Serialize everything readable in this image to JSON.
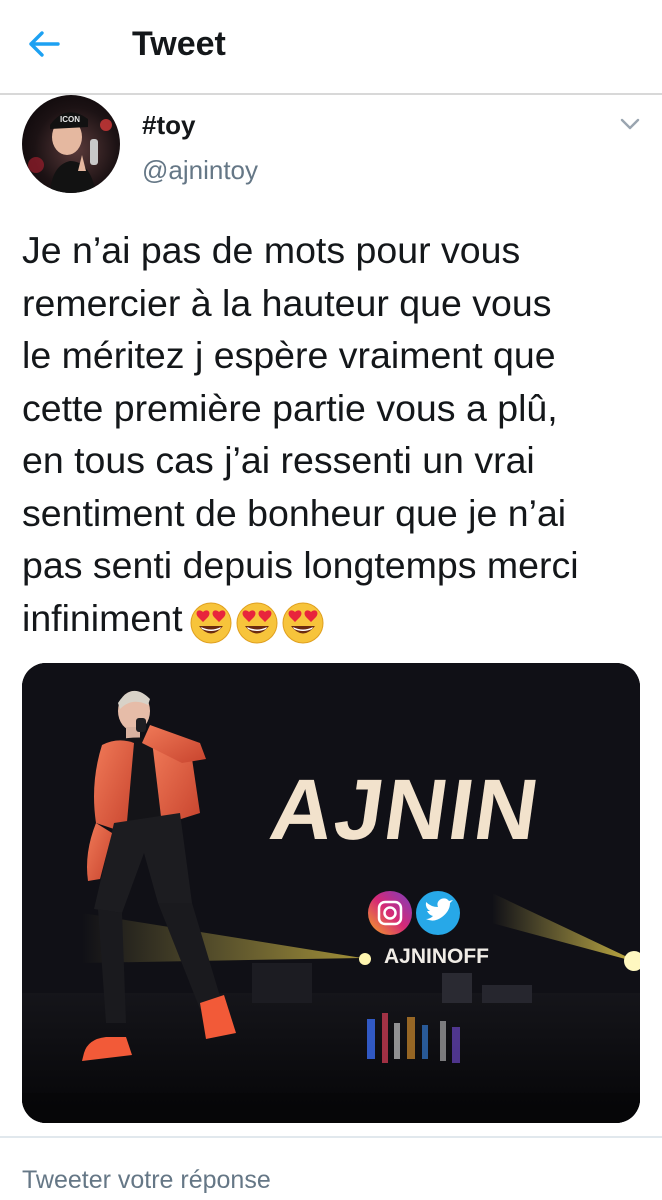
{
  "header": {
    "title": "Tweet",
    "back_icon": "arrow-left-icon"
  },
  "tweet": {
    "display_name": "#toy",
    "username": "@ajnintoy",
    "avatar_cap_text": "ICON",
    "text_lines": [
      "Je n’ai pas de mots pour vous",
      "remercier à la hauteur que vous",
      "le méritez j espère vraiment que",
      "cette première partie vous a plû,",
      "en tous cas j’ai ressenti un vrai",
      "sentiment de bonheur que je n’ai",
      "pas senti depuis longtemps merci",
      "infiniment"
    ],
    "emojis": [
      "heart-eyes-emoji",
      "heart-eyes-emoji",
      "heart-eyes-emoji"
    ]
  },
  "media": {
    "stage_logo_text": "AJNIN",
    "stage_handle_text": "AJNINOFF",
    "social_icons": [
      "instagram-icon",
      "twitter-icon"
    ]
  },
  "reply": {
    "placeholder": "Tweeter votre réponse"
  },
  "colors": {
    "accent": "#1da1f2",
    "text": "#14171a",
    "secondary": "#657786",
    "divider": "#e1e8ed"
  }
}
